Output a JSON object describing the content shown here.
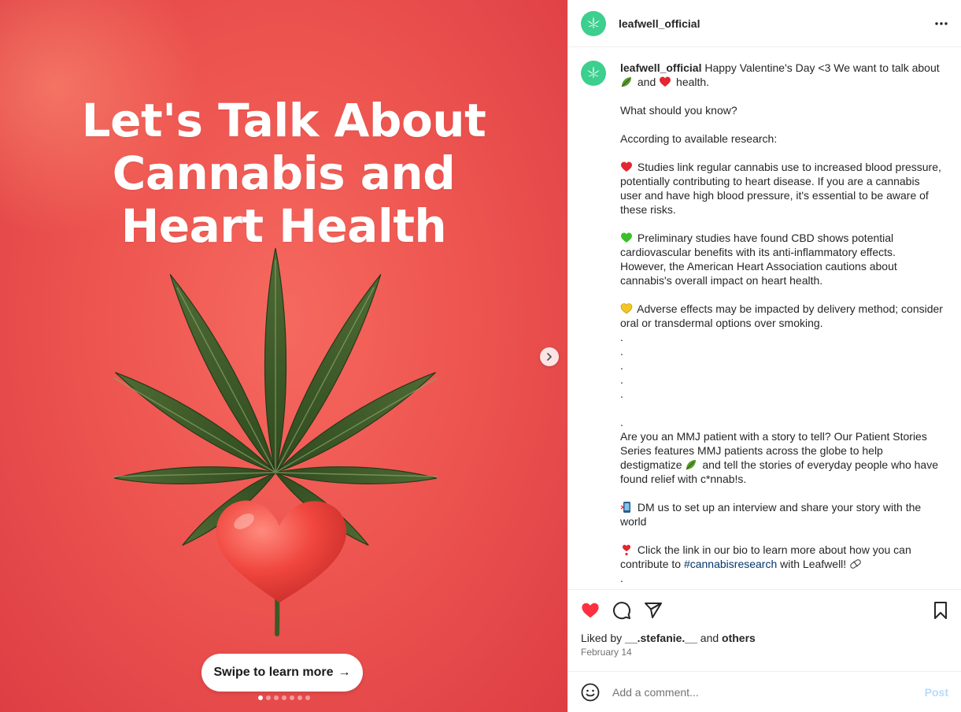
{
  "media": {
    "headline_lines": [
      "Let's Talk About",
      "Cannabis and",
      "Heart Health"
    ],
    "swipe_label": "Swipe to learn more",
    "swipe_arrow": "→",
    "dot_count": 7,
    "active_dot": 1,
    "background_color": "#ee5550"
  },
  "post": {
    "username": "leafwell_official",
    "avatar_color": "#3ccf8e",
    "caption": {
      "username": "leafwell_official",
      "intro": "Happy Valentine's Day <3 We want to talk about",
      "intro_and": "and",
      "intro_end": "health.",
      "question": "What should you know?",
      "according": "According to available research:",
      "point_red": "Studies link regular cannabis use to increased blood pressure, potentially contributing to heart disease. If you are a cannabis user and have high blood pressure, it's essential to be aware of these risks.",
      "point_green": "Preliminary studies have found CBD shows potential cardiovascular benefits with its anti-inflammatory effects. However, the American Heart Association cautions about cannabis's overall impact on heart health.",
      "point_yellow": "Adverse effects may be impacted by delivery method; consider oral or transdermal options over smoking.",
      "dot": ".",
      "patient_1": "Are you an MMJ patient with a story to tell? Our Patient Stories Series features MMJ patients across the globe to help destigmatize",
      "patient_2": "and tell the stories of everyday people who have found relief with c*nnab!s.",
      "dm": "DM us to set up an interview and share your story with the world",
      "link_1": "Click the link in our bio to learn more about how you can contribute to",
      "hashtag": "#cannabisresearch",
      "link_2": "with Leafwell!"
    },
    "liked_by_prefix": "Liked by",
    "liked_by_user": "__.stefanie.__",
    "liked_by_and": "and",
    "liked_by_others": "others",
    "date": "February 14",
    "comment_placeholder": "Add a comment...",
    "post_label": "Post",
    "like_color": "#ff3040"
  },
  "icons": {
    "more": "more-horizontal-icon",
    "like": "heart-filled-icon",
    "comment": "comment-icon",
    "share": "send-icon",
    "save": "bookmark-icon",
    "emoji": "smiley-icon",
    "next": "chevron-right-icon"
  }
}
